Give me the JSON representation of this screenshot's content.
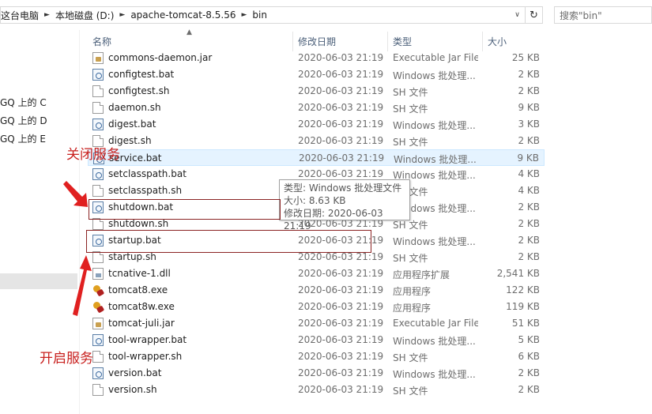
{
  "address": {
    "crumbs": [
      "这台电脑",
      "本地磁盘 (D:)",
      "apache-tomcat-8.5.56",
      "bin"
    ]
  },
  "search": {
    "placeholder": "搜索\"bin\""
  },
  "nav": {
    "items": [
      "GQ 上的 C",
      "GQ 上的 D",
      "GQ 上的 E"
    ]
  },
  "columns": {
    "name": "名称",
    "date": "修改日期",
    "type": "类型",
    "size": "大小"
  },
  "files": [
    {
      "name": "commons-daemon.jar",
      "date": "2020-06-03 21:19",
      "type": "Executable Jar File",
      "size": "25 KB",
      "icon": "jar-icon"
    },
    {
      "name": "configtest.bat",
      "date": "2020-06-03 21:19",
      "type": "Windows 批处理...",
      "size": "2 KB",
      "icon": "bat-icon"
    },
    {
      "name": "configtest.sh",
      "date": "2020-06-03 21:19",
      "type": "SH 文件",
      "size": "2 KB",
      "icon": "file-icon"
    },
    {
      "name": "daemon.sh",
      "date": "2020-06-03 21:19",
      "type": "SH 文件",
      "size": "9 KB",
      "icon": "file-icon"
    },
    {
      "name": "digest.bat",
      "date": "2020-06-03 21:19",
      "type": "Windows 批处理...",
      "size": "3 KB",
      "icon": "bat-icon"
    },
    {
      "name": "digest.sh",
      "date": "2020-06-03 21:19",
      "type": "SH 文件",
      "size": "2 KB",
      "icon": "file-icon"
    },
    {
      "name": "service.bat",
      "date": "2020-06-03 21:19",
      "type": "Windows 批处理...",
      "size": "9 KB",
      "icon": "bat-icon"
    },
    {
      "name": "setclasspath.bat",
      "date": "2020-06-03 21:19",
      "type": "Windows 批处理...",
      "size": "4 KB",
      "icon": "bat-icon"
    },
    {
      "name": "setclasspath.sh",
      "date": "2020-06-03 21:19",
      "type": "SH 文件",
      "size": "4 KB",
      "icon": "file-icon"
    },
    {
      "name": "shutdown.bat",
      "date": "2020-06-03 21:19",
      "type": "Windows 批处理...",
      "size": "2 KB",
      "icon": "bat-icon"
    },
    {
      "name": "shutdown.sh",
      "date": "2020-06-03 21:19",
      "type": "SH 文件",
      "size": "2 KB",
      "icon": "file-icon"
    },
    {
      "name": "startup.bat",
      "date": "2020-06-03 21:19",
      "type": "Windows 批处理...",
      "size": "2 KB",
      "icon": "bat-icon"
    },
    {
      "name": "startup.sh",
      "date": "2020-06-03 21:19",
      "type": "SH 文件",
      "size": "2 KB",
      "icon": "file-icon"
    },
    {
      "name": "tcnative-1.dll",
      "date": "2020-06-03 21:19",
      "type": "应用程序扩展",
      "size": "2,541 KB",
      "icon": "dll-icon"
    },
    {
      "name": "tomcat8.exe",
      "date": "2020-06-03 21:19",
      "type": "应用程序",
      "size": "122 KB",
      "icon": "tomcat-exe-icon"
    },
    {
      "name": "tomcat8w.exe",
      "date": "2020-06-03 21:19",
      "type": "应用程序",
      "size": "119 KB",
      "icon": "tomcat-exe-icon"
    },
    {
      "name": "tomcat-juli.jar",
      "date": "2020-06-03 21:19",
      "type": "Executable Jar File",
      "size": "51 KB",
      "icon": "jar-icon"
    },
    {
      "name": "tool-wrapper.bat",
      "date": "2020-06-03 21:19",
      "type": "Windows 批处理...",
      "size": "5 KB",
      "icon": "bat-icon"
    },
    {
      "name": "tool-wrapper.sh",
      "date": "2020-06-03 21:19",
      "type": "SH 文件",
      "size": "6 KB",
      "icon": "file-icon"
    },
    {
      "name": "version.bat",
      "date": "2020-06-03 21:19",
      "type": "Windows 批处理...",
      "size": "2 KB",
      "icon": "bat-icon"
    },
    {
      "name": "version.sh",
      "date": "2020-06-03 21:19",
      "type": "SH 文件",
      "size": "2 KB",
      "icon": "file-icon"
    }
  ],
  "tooltip": {
    "type": "类型: Windows 批处理文件",
    "size": "大小: 8.63 KB",
    "date": "修改日期: 2020-06-03 21:19"
  },
  "annotations": {
    "stop_label": "关闭服务",
    "start_label": "开启服务",
    "color": "#c8201e"
  }
}
